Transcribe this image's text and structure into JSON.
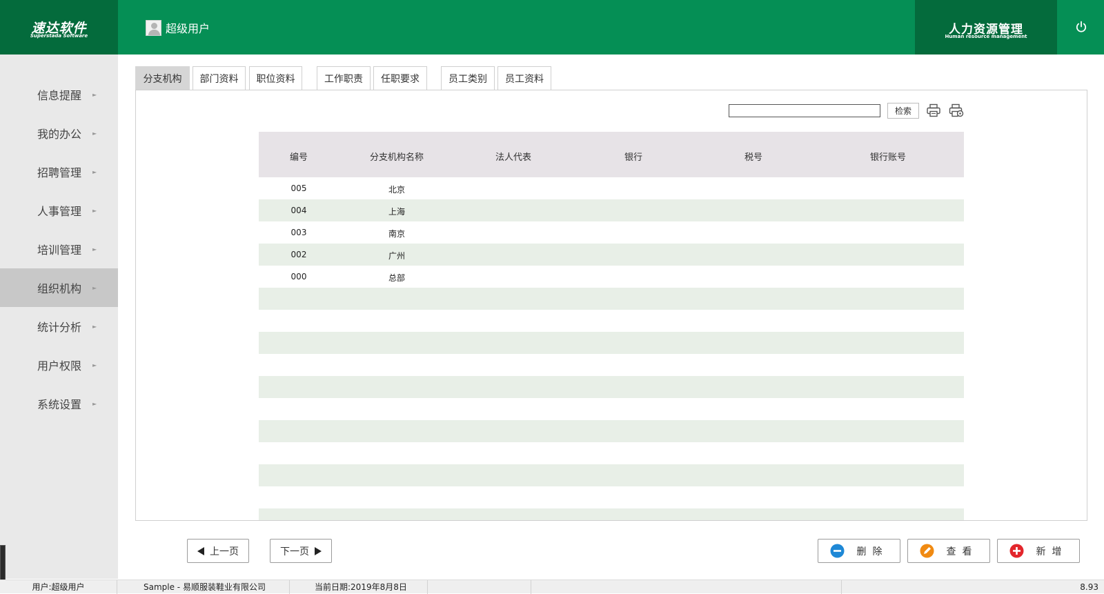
{
  "header": {
    "logo_cn": "速达软件",
    "logo_en": "Superstada Software",
    "user_name": "超级用户",
    "module_cn": "人力资源管理",
    "module_en": "Human resource management",
    "brand_color": "#058f55",
    "brand_dark": "#046b3c"
  },
  "sidebar": {
    "items": [
      {
        "label": "信息提醒"
      },
      {
        "label": "我的办公"
      },
      {
        "label": "招聘管理"
      },
      {
        "label": "人事管理"
      },
      {
        "label": "培训管理"
      },
      {
        "label": "组织机构",
        "active": true
      },
      {
        "label": "统计分析"
      },
      {
        "label": "用户权限"
      },
      {
        "label": "系统设置"
      }
    ],
    "arrow": "►"
  },
  "tabs": [
    {
      "label": "分支机构",
      "active": true
    },
    {
      "label": "部门资料"
    },
    {
      "label": "职位资料"
    },
    {
      "label": "工作职责"
    },
    {
      "label": "任职要求"
    },
    {
      "label": "员工类别"
    },
    {
      "label": "员工资料"
    }
  ],
  "toolbar": {
    "search_value": "",
    "search_button": "检索",
    "print_icon": "printer-icon",
    "print_setup_icon": "print-setup-icon"
  },
  "table": {
    "columns": [
      "编号",
      "分支机构名称",
      "法人代表",
      "银行",
      "税号",
      "银行账号"
    ],
    "rows": [
      [
        "005",
        "北京",
        "",
        "",
        "",
        ""
      ],
      [
        "004",
        "上海",
        "",
        "",
        "",
        ""
      ],
      [
        "003",
        "南京",
        "",
        "",
        "",
        ""
      ],
      [
        "002",
        "广州",
        "",
        "",
        "",
        ""
      ],
      [
        "000",
        "总部",
        "",
        "",
        "",
        ""
      ]
    ]
  },
  "pagination": {
    "prev_label": "上一页",
    "next_label": "下一页"
  },
  "actions": {
    "delete_label": "删除",
    "view_label": "查看",
    "add_label": "新增",
    "delete_color": "#1e88d6",
    "view_color": "#f08a12",
    "add_color": "#e3262c"
  },
  "statusbar": {
    "user": "用户:超级用户",
    "company": "Sample - 易顺服装鞋业有限公司",
    "date": "当前日期:2019年8月8日",
    "version": "8.93"
  }
}
